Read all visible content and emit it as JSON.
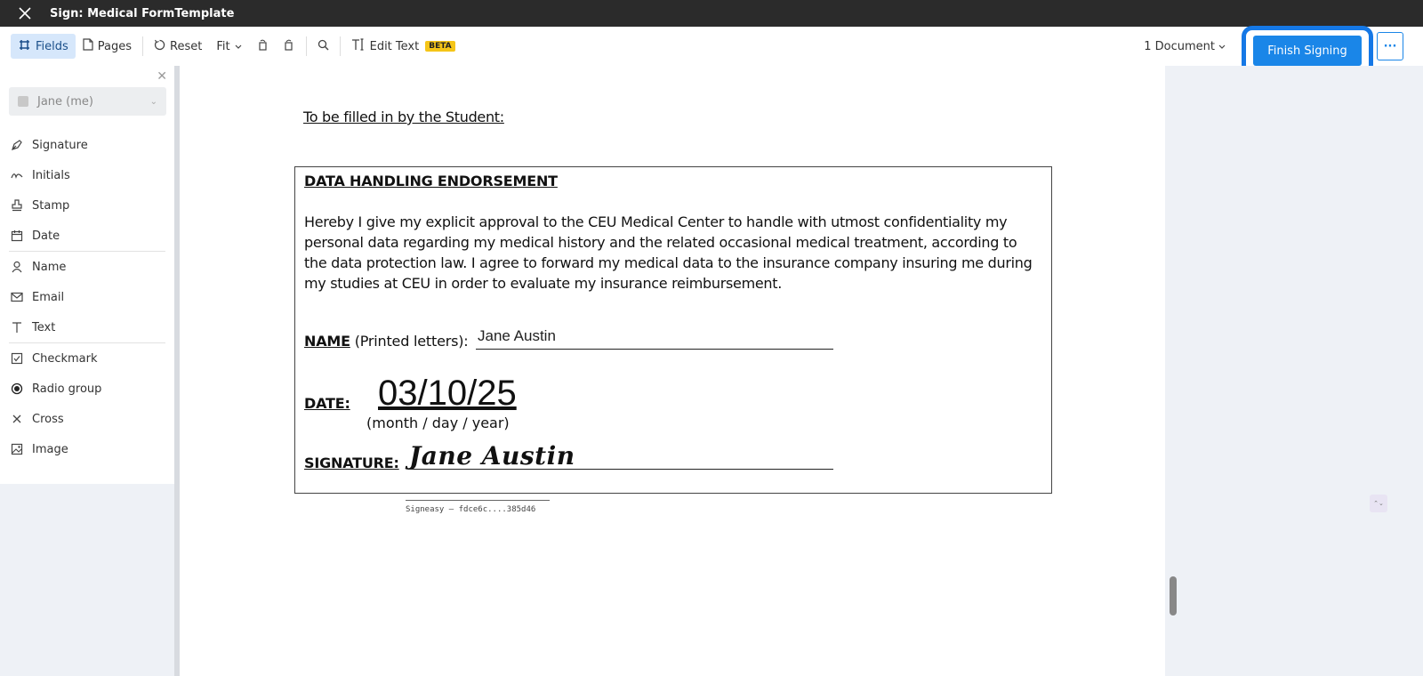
{
  "window": {
    "title": "Sign: Medical FormTemplate"
  },
  "toolbar": {
    "fields_label": "Fields",
    "pages_label": "Pages",
    "reset_label": "Reset",
    "fit_label": "Fit",
    "edit_text_label": "Edit Text",
    "beta_label": "BETA",
    "document_selector": "1 Document",
    "finish_label": "Finish Signing",
    "more_label": "···"
  },
  "sidebar": {
    "signer": "Jane (me)",
    "groups": [
      [
        {
          "label": "Signature",
          "icon": "pen-nib-icon"
        },
        {
          "label": "Initials",
          "icon": "initials-icon"
        },
        {
          "label": "Stamp",
          "icon": "stamp-icon"
        },
        {
          "label": "Date",
          "icon": "calendar-icon"
        }
      ],
      [
        {
          "label": "Name",
          "icon": "person-icon"
        },
        {
          "label": "Email",
          "icon": "envelope-icon"
        },
        {
          "label": "Text",
          "icon": "text-icon"
        }
      ],
      [
        {
          "label": "Checkmark",
          "icon": "checkbox-icon"
        },
        {
          "label": "Radio group",
          "icon": "radio-icon"
        },
        {
          "label": "Cross",
          "icon": "cross-icon"
        },
        {
          "label": "Image",
          "icon": "image-icon"
        }
      ]
    ]
  },
  "document": {
    "heading": "To be filled in by the Student:",
    "box_title": "DATA HANDLING ENDORSEMENT",
    "body": "Hereby I give my explicit approval to the CEU Medical Center to handle with utmost confidentiality my personal data regarding my medical history and the related occasional medical treatment, according to the data protection law. I agree to forward my medical data to the insurance company insuring me during my studies at CEU in order to evaluate my insurance reimbursement.",
    "name_label": "NAME",
    "name_hint": " (Printed letters):",
    "name_value": "Jane Austin",
    "date_label": "DATE:",
    "date_value": "03/10/25",
    "date_hint": "(month / day / year)",
    "signature_label": "SIGNATURE:",
    "signature_value": "Jane Austin",
    "stamp": "Signeasy – fdce6c....385d46"
  },
  "colors": {
    "accent": "#1a86e8",
    "highlight": "#1578e6",
    "titlebar": "#2b2b2b"
  }
}
